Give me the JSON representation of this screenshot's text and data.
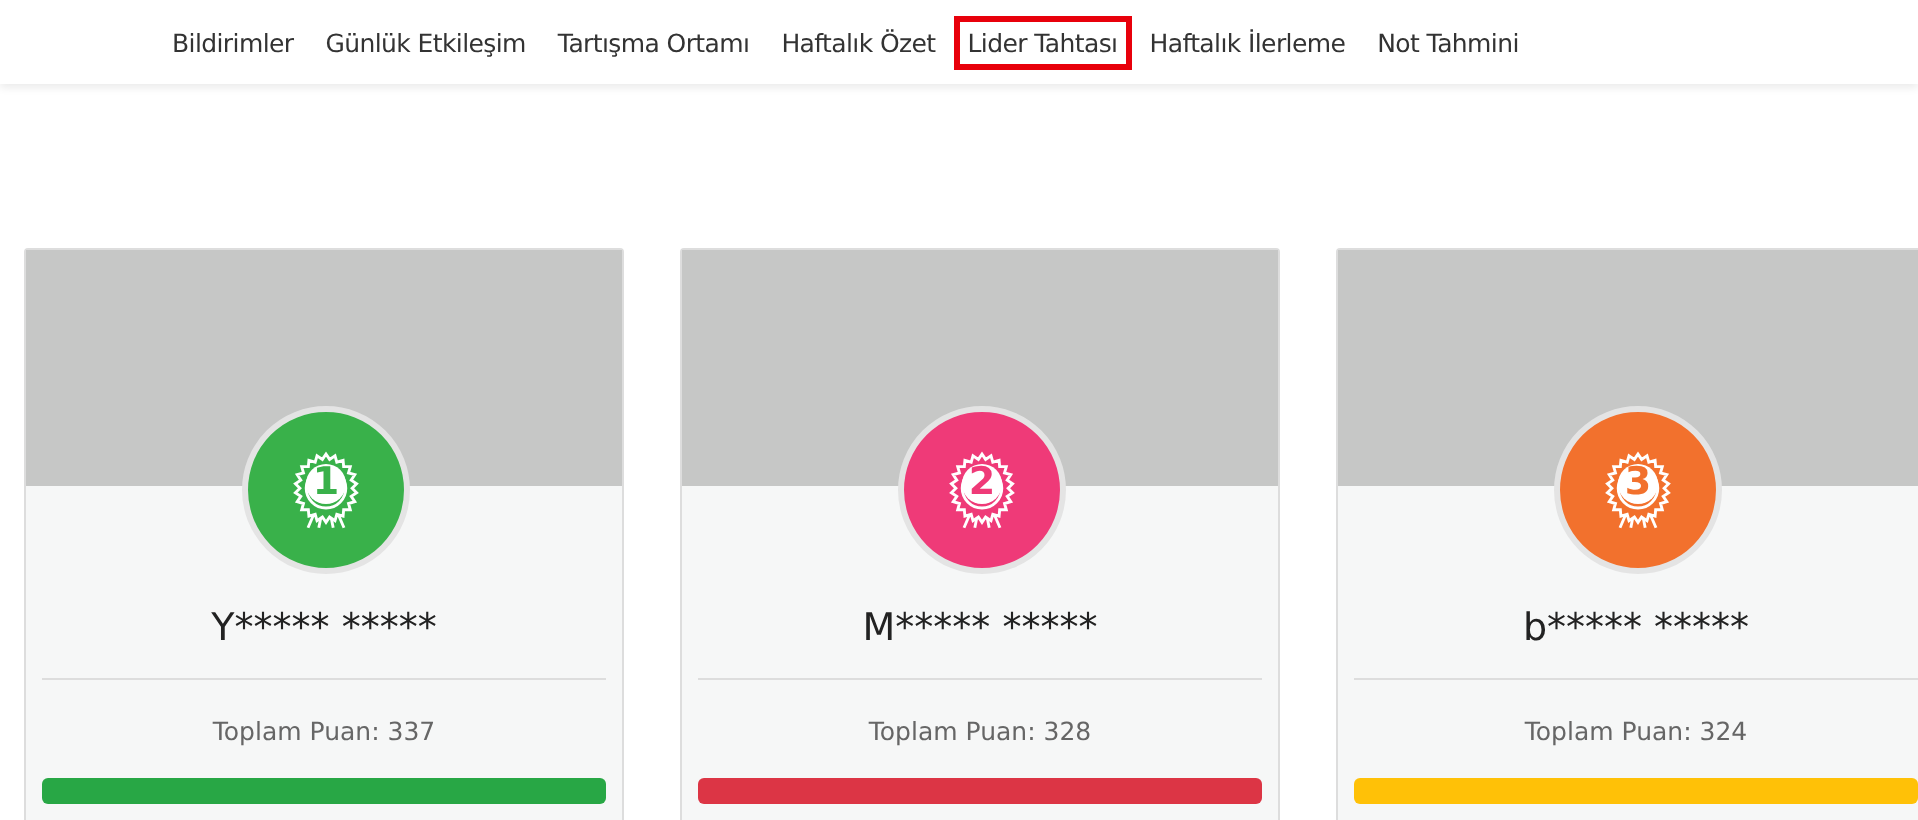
{
  "nav": [
    {
      "label": "Bildirimler",
      "selected": false
    },
    {
      "label": "Günlük Etkileşim",
      "selected": false
    },
    {
      "label": "Tartışma Ortamı",
      "selected": false
    },
    {
      "label": "Haftalık Özet",
      "selected": false
    },
    {
      "label": "Lider Tahtası",
      "selected": true
    },
    {
      "label": "Haftalık İlerleme",
      "selected": false
    },
    {
      "label": "Not Tahmini",
      "selected": false
    }
  ],
  "leaders": [
    {
      "rank": "1",
      "color": "#39b14a",
      "name": "Y***** *****",
      "score": "Toplam Puan: 337",
      "bar": {
        "color": "#28a745"
      }
    },
    {
      "rank": "2",
      "color": "#ef3a78",
      "name": "M***** *****",
      "score": "Toplam Puan: 328",
      "bar": {
        "color": "#dc3545"
      }
    },
    {
      "rank": "3",
      "color": "#f2712d",
      "name": "b***** *****",
      "score": "Toplam Puan: 324",
      "bar": {
        "color": "#ffc107"
      }
    }
  ]
}
